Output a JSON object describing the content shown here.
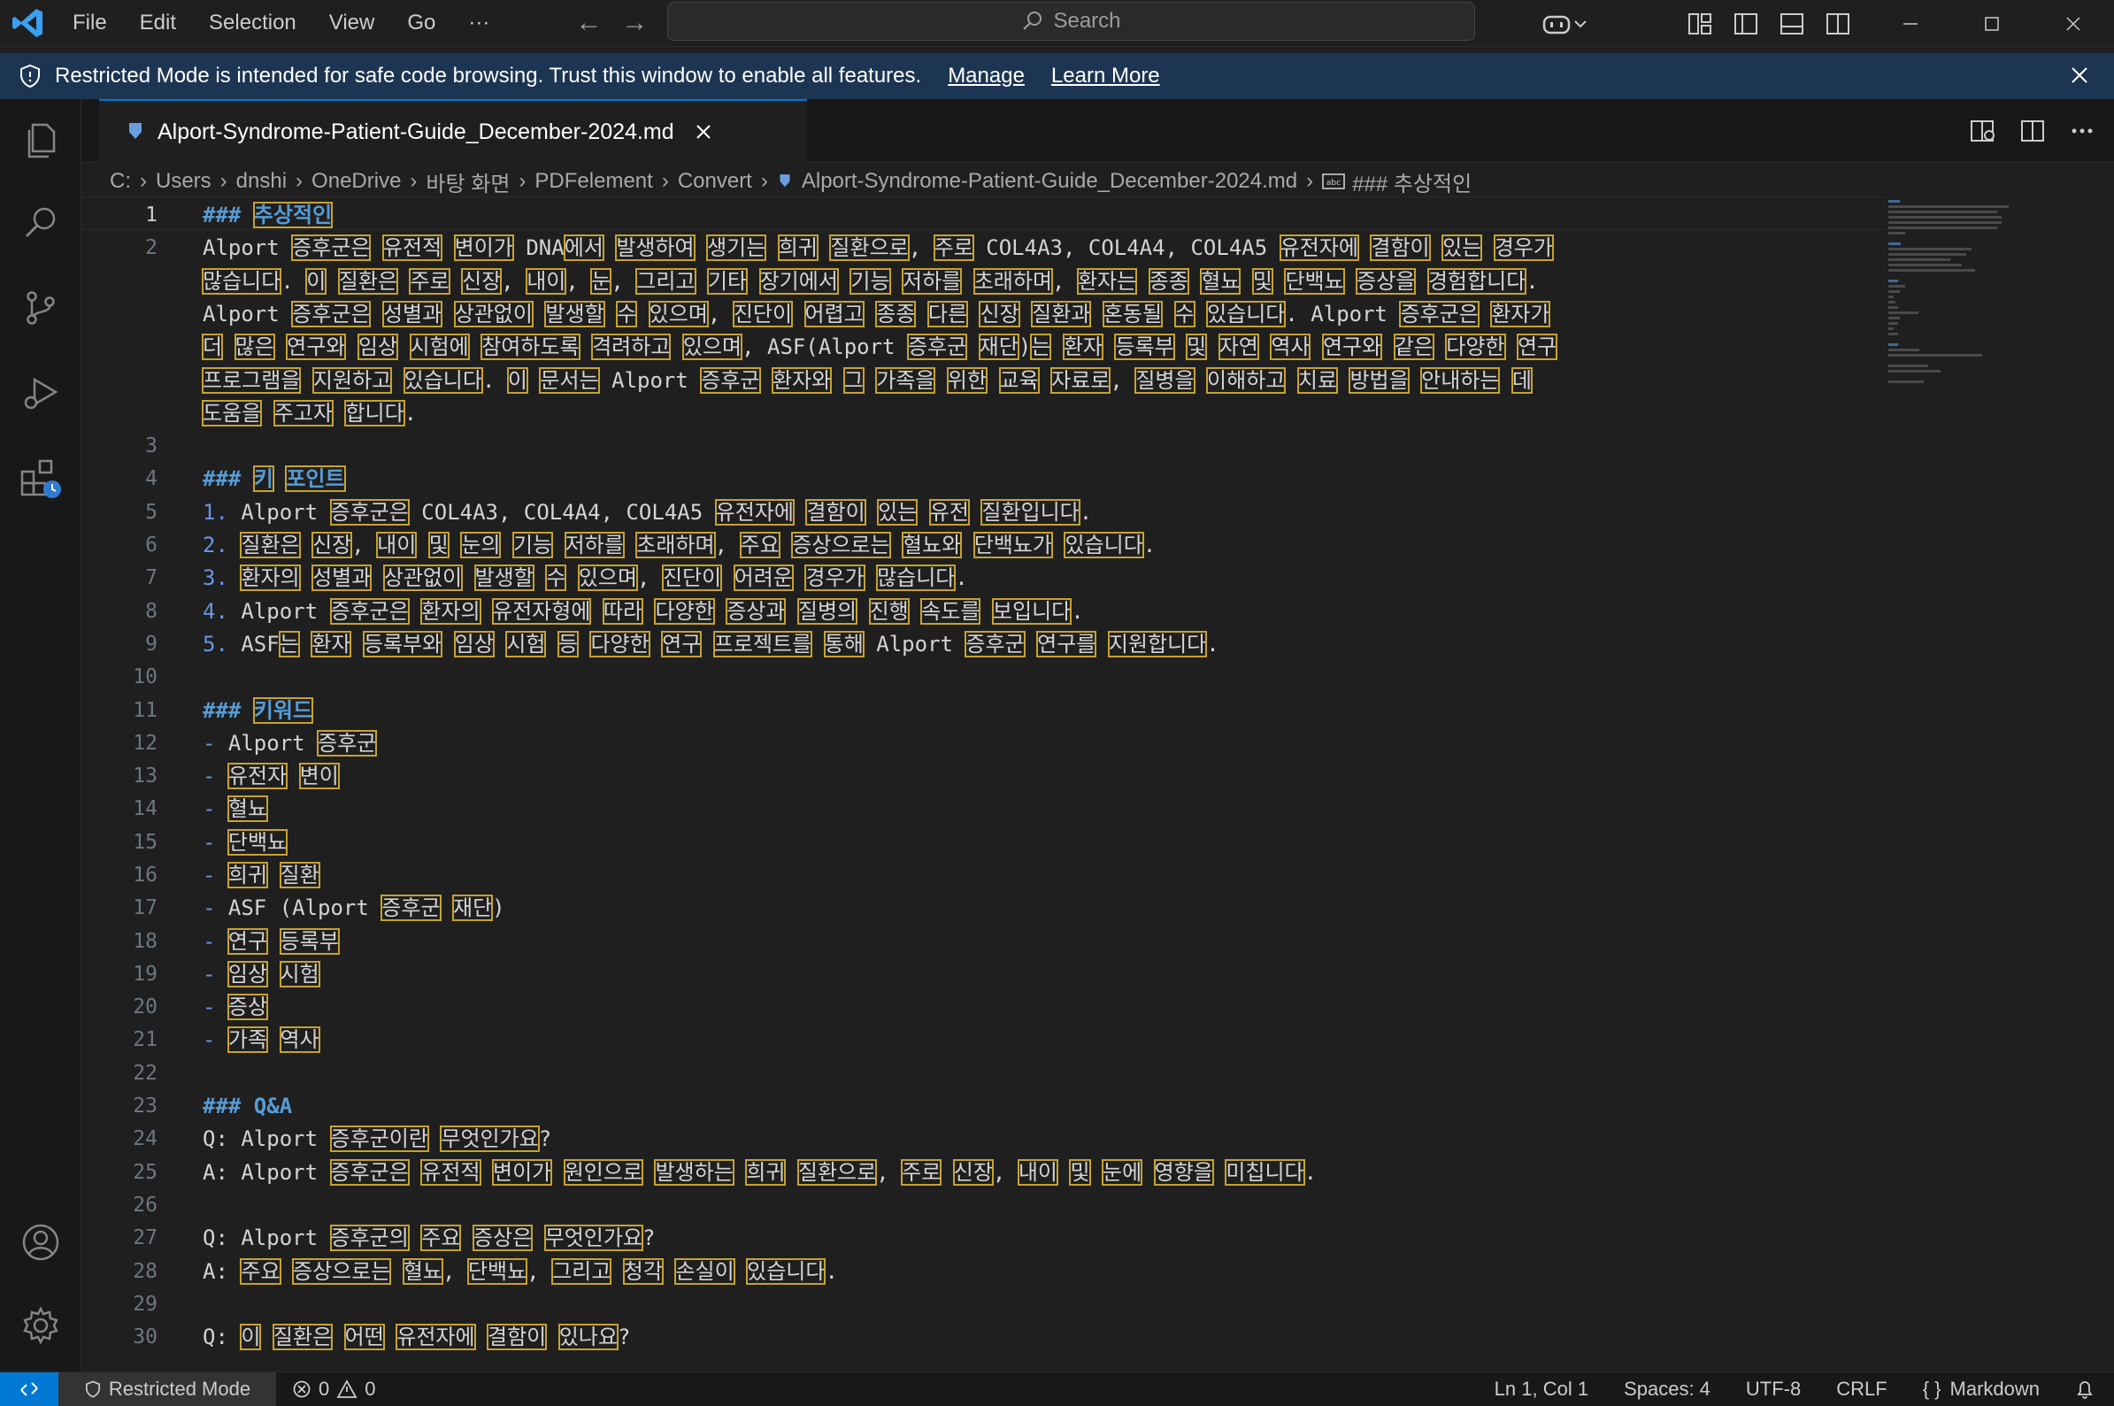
{
  "titlebar": {
    "menu": [
      "File",
      "Edit",
      "Selection",
      "View",
      "Go",
      "···"
    ],
    "search_label": "Search"
  },
  "banner": {
    "message": "Restricted Mode is intended for safe code browsing. Trust this window to enable all features.",
    "manage_label": "Manage",
    "learn_more_label": "Learn More"
  },
  "tab": {
    "label": "Alport-Syndrome-Patient-Guide_December-2024.md"
  },
  "breadcrumbs": [
    "C:",
    "Users",
    "dnshi",
    "OneDrive",
    "바탕 화면",
    "PDFelement",
    "Convert",
    "Alport-Syndrome-Patient-Guide_December-2024.md",
    "### 추상적인"
  ],
  "editor": {
    "lines": [
      {
        "n": "1",
        "text": "### 추상적인"
      },
      {
        "n": "2",
        "text": "Alport 증후군은 유전적 변이가 DNA에서 발생하여 생기는 희귀 질환으로, 주로 COL4A3, COL4A4, COL4A5 유전자에 결함이 있는 경우가"
      },
      {
        "n": "",
        "text": "많습니다. 이 질환은 주로 신장, 내이, 눈, 그리고 기타 장기에서 기능 저하를 초래하며, 환자는 종종 혈뇨 및 단백뇨 증상을 경험합니다."
      },
      {
        "n": "",
        "text": "Alport 증후군은 성별과 상관없이 발생할 수 있으며, 진단이 어렵고 종종 다른 신장 질환과 혼동될 수 있습니다. Alport 증후군은 환자가"
      },
      {
        "n": "",
        "text": "더 많은 연구와 임상 시험에 참여하도록 격려하고 있으며, ASF(Alport 증후군 재단)는 환자 등록부 및 자연 역사 연구와 같은 다양한 연구"
      },
      {
        "n": "",
        "text": "프로그램을 지원하고 있습니다. 이 문서는 Alport 증후군 환자와 그 가족을 위한 교육 자료로, 질병을 이해하고 치료 방법을 안내하는 데"
      },
      {
        "n": "",
        "text": "도움을 주고자 합니다."
      },
      {
        "n": "3",
        "text": ""
      },
      {
        "n": "4",
        "text": "### 키 포인트"
      },
      {
        "n": "5",
        "text": "1. Alport 증후군은 COL4A3, COL4A4, COL4A5 유전자에 결함이 있는 유전 질환입니다."
      },
      {
        "n": "6",
        "text": "2. 질환은 신장, 내이 및 눈의 기능 저하를 초래하며, 주요 증상으로는 혈뇨와 단백뇨가 있습니다."
      },
      {
        "n": "7",
        "text": "3. 환자의 성별과 상관없이 발생할 수 있으며, 진단이 어려운 경우가 많습니다."
      },
      {
        "n": "8",
        "text": "4. Alport 증후군은 환자의 유전자형에 따라 다양한 증상과 질병의 진행 속도를 보입니다."
      },
      {
        "n": "9",
        "text": "5. ASF는 환자 등록부와 임상 시험 등 다양한 연구 프로젝트를 통해 Alport 증후군 연구를 지원합니다."
      },
      {
        "n": "10",
        "text": ""
      },
      {
        "n": "11",
        "text": "### 키워드"
      },
      {
        "n": "12",
        "text": "- Alport 증후군"
      },
      {
        "n": "13",
        "text": "- 유전자 변이"
      },
      {
        "n": "14",
        "text": "- 혈뇨"
      },
      {
        "n": "15",
        "text": "- 단백뇨"
      },
      {
        "n": "16",
        "text": "- 희귀 질환"
      },
      {
        "n": "17",
        "text": "- ASF (Alport 증후군 재단)"
      },
      {
        "n": "18",
        "text": "- 연구 등록부"
      },
      {
        "n": "19",
        "text": "- 임상 시험"
      },
      {
        "n": "20",
        "text": "- 증상"
      },
      {
        "n": "21",
        "text": "- 가족 역사"
      },
      {
        "n": "22",
        "text": ""
      },
      {
        "n": "23",
        "text": "### Q&A"
      },
      {
        "n": "24",
        "text": "Q: Alport 증후군이란 무엇인가요?"
      },
      {
        "n": "25",
        "text": "A: Alport 증후군은 유전적 변이가 원인으로 발생하는 희귀 질환으로, 주로 신장, 내이 및 눈에 영향을 미칩니다."
      },
      {
        "n": "26",
        "text": ""
      },
      {
        "n": "27",
        "text": "Q: Alport 증후군의 주요 증상은 무엇인가요?"
      },
      {
        "n": "28",
        "text": "A: 주요 증상으로는 혈뇨, 단백뇨, 그리고 청각 손실이 있습니다."
      },
      {
        "n": "29",
        "text": ""
      },
      {
        "n": "30",
        "text": "Q: 이 질환은 어떤 유전자에 결함이 있나요?"
      }
    ]
  },
  "statusbar": {
    "restricted_label": "Restricted Mode",
    "errors": "0",
    "warnings": "0",
    "cursor": "Ln 1, Col 1",
    "spaces": "Spaces: 4",
    "encoding": "UTF-8",
    "eol": "CRLF",
    "language": "Markdown"
  },
  "colors": {
    "accent": "#0078d4",
    "heading": "#569cd6",
    "unicode_highlight": "#c7a230",
    "banner_bg": "#1c3553"
  }
}
